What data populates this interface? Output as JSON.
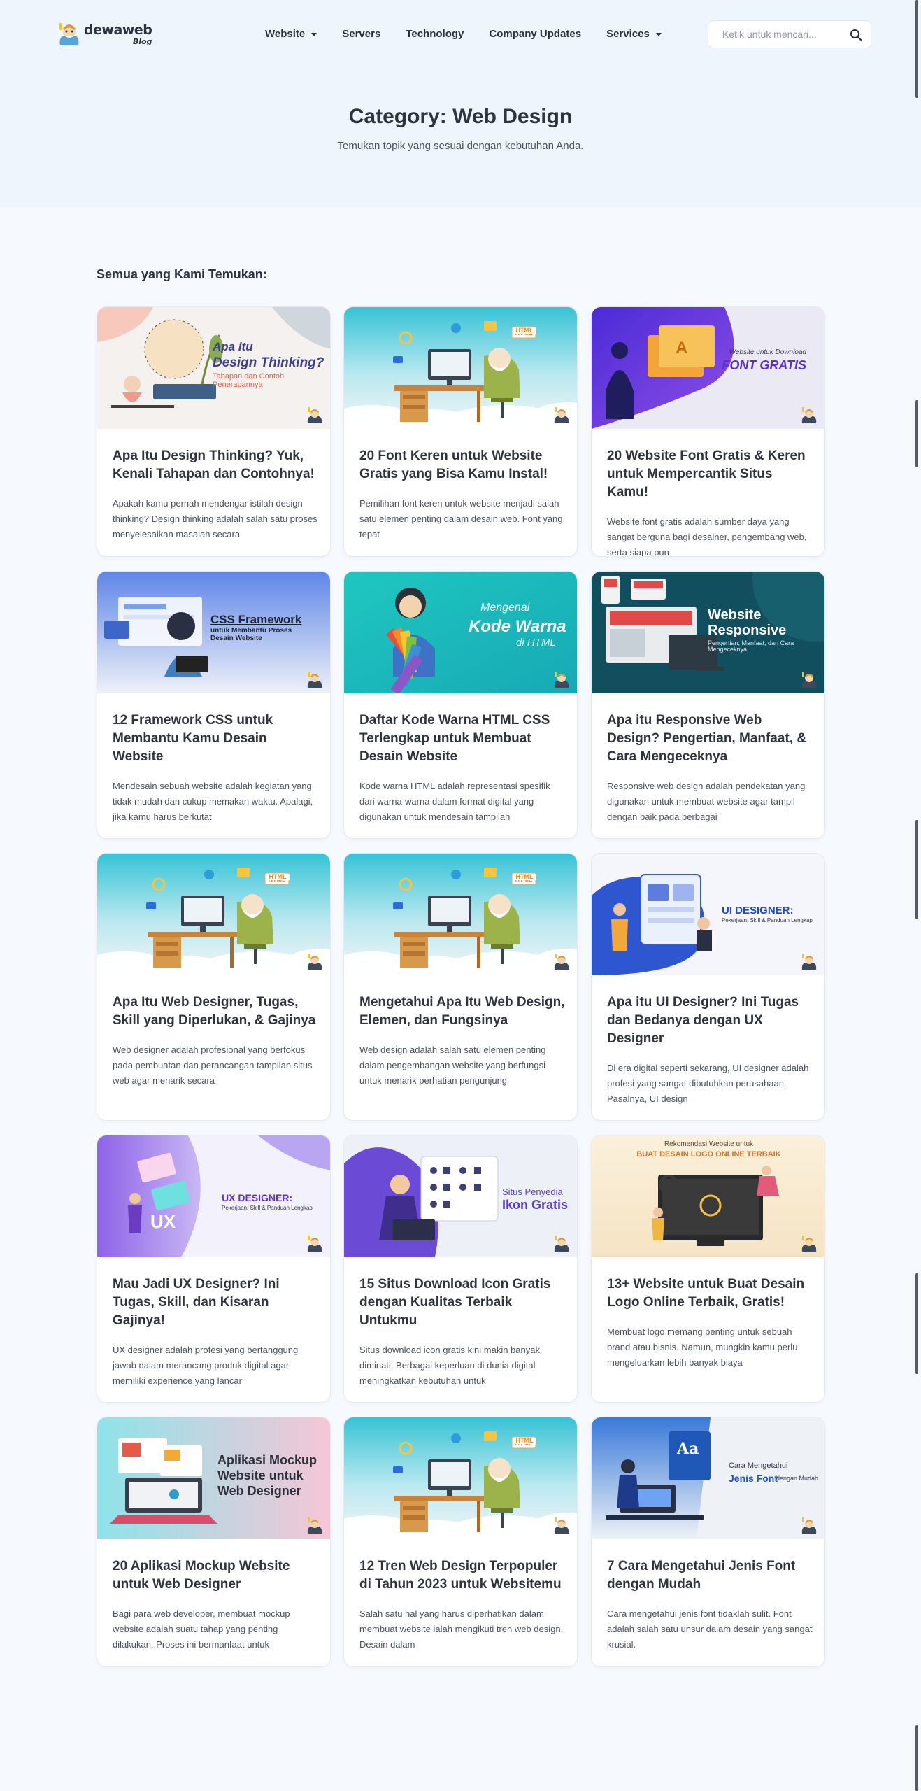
{
  "brand": {
    "name": "dewaweb",
    "sub": "Blog"
  },
  "nav": [
    {
      "label": "Website",
      "dropdown": true
    },
    {
      "label": "Servers",
      "dropdown": false
    },
    {
      "label": "Technology",
      "dropdown": false
    },
    {
      "label": "Company Updates",
      "dropdown": false
    },
    {
      "label": "Services",
      "dropdown": true
    }
  ],
  "search": {
    "placeholder": "Ketik untuk mencari...",
    "icon": "search-icon"
  },
  "hero": {
    "title": "Category: Web Design",
    "subtitle": "Temukan topik yang sesuai dengan kebutuhan Anda."
  },
  "section_label": "Semua yang Kami Temukan:",
  "posts": [
    {
      "title": "Apa Itu Design Thinking? Yuk, Kenali Tahapan dan Contohnya!",
      "excerpt": "Apakah kamu pernah mendengar istilah design thinking? Design thinking adalah salah satu proses menyelesaikan masalah secara",
      "thumb": {
        "kind": "design-thinking",
        "line1": "Apa itu",
        "line2": "Design Thinking?",
        "line3": "Tahapan dan Contoh Penerapannya"
      }
    },
    {
      "title": "20 Font Keren untuk Website Gratis yang Bisa Kamu Instal!",
      "excerpt": "Pemilihan font keren untuk website menjadi salah satu elemen penting dalam desain web. Font yang tepat",
      "thumb": {
        "kind": "desk",
        "line1": "HTML"
      }
    },
    {
      "title": "20 Website Font Gratis & Keren untuk Mempercantik Situs Kamu!",
      "excerpt": "Website font gratis adalah sumber daya yang sangat berguna bagi desainer, pengembang web, serta siapa pun",
      "thumb": {
        "kind": "font-gratis",
        "line1": "Website untuk Download",
        "line2": "FONT GRATIS"
      }
    },
    {
      "title": "12 Framework CSS untuk Membantu Kamu Desain Website",
      "excerpt": "Mendesain sebuah website adalah kegiatan yang tidak mudah dan cukup memakan waktu. Apalagi, jika kamu harus berkutat",
      "thumb": {
        "kind": "css-framework",
        "line1": "CSS Framework",
        "line2": "untuk Membantu Proses Desain Website"
      }
    },
    {
      "title": "Daftar Kode Warna HTML CSS Terlengkap untuk Membuat Desain Website",
      "excerpt": "Kode warna HTML adalah representasi spesifik dari warna-warna dalam format digital yang digunakan untuk mendesain tampilan",
      "thumb": {
        "kind": "kode-warna",
        "line1": "Mengenal",
        "line2": "Kode Warna",
        "line3": "di HTML"
      }
    },
    {
      "title": "Apa itu Responsive Web Design? Pengertian, Manfaat, & Cara Mengeceknya",
      "excerpt": "Responsive web design adalah pendekatan yang digunakan untuk membuat website agar tampil dengan baik pada berbagai",
      "thumb": {
        "kind": "responsive",
        "line1": "Website",
        "line2": "Responsive",
        "line3": "Pengertian, Manfaat, dan Cara Mengeceknya"
      }
    },
    {
      "title": "Apa Itu Web Designer, Tugas, Skill yang Diperlukan, & Gajinya",
      "excerpt": "Web designer adalah profesional yang berfokus pada pembuatan dan perancangan tampilan situs web agar menarik secara",
      "thumb": {
        "kind": "desk",
        "line1": "HTML"
      }
    },
    {
      "title": "Mengetahui Apa Itu Web Design, Elemen, dan Fungsinya",
      "excerpt": "Web design adalah salah satu elemen penting dalam pengembangan website yang berfungsi untuk menarik perhatian pengunjung",
      "thumb": {
        "kind": "desk",
        "line1": "HTML"
      }
    },
    {
      "title": "Apa itu UI Designer? Ini Tugas dan Bedanya dengan UX Designer",
      "excerpt": "Di era digital seperti sekarang, UI designer adalah profesi yang sangat dibutuhkan perusahaan. Pasalnya, UI design",
      "thumb": {
        "kind": "ui-designer",
        "line1": "UI DESIGNER:",
        "line2": "Pekerjaan, Skill & Panduan Lengkap"
      }
    },
    {
      "title": "Mau Jadi UX Designer? Ini Tugas, Skill, dan Kisaran Gajinya!",
      "excerpt": "UX designer adalah profesi yang bertanggung jawab dalam merancang produk digital agar memiliki experience yang lancar",
      "thumb": {
        "kind": "ux-designer",
        "line1": "UX DESIGNER:",
        "line2": "Pekerjaan, Skill & Panduan Lengkap"
      }
    },
    {
      "title": "15 Situs Download Icon Gratis dengan Kualitas Terbaik Untukmu",
      "excerpt": "Situs download icon gratis kini makin banyak diminati. Berbagai keperluan di dunia digital meningkatkan kebutuhan untuk",
      "thumb": {
        "kind": "ikon-gratis",
        "line1": "Situs Penyedia",
        "line2": "Ikon Gratis"
      }
    },
    {
      "title": "13+ Website untuk Buat Desain Logo Online Terbaik, Gratis!",
      "excerpt": "Membuat logo memang penting untuk sebuah brand atau bisnis. Namun, mungkin kamu perlu mengeluarkan lebih banyak biaya",
      "thumb": {
        "kind": "logo-online",
        "line1": "Rekomendasi Website untuk",
        "line2": "BUAT DESAIN LOGO ONLINE TERBAIK"
      }
    },
    {
      "title": "20 Aplikasi Mockup Website untuk Web Designer",
      "excerpt": "Bagi para web developer, membuat mockup website adalah suatu tahap yang penting dilakukan. Proses ini bermanfaat untuk",
      "thumb": {
        "kind": "mockup",
        "line1": "Aplikasi Mockup",
        "line2": "Website untuk",
        "line3": "Web Designer"
      }
    },
    {
      "title": "12 Tren Web Design Terpopuler di Tahun 2023 untuk Websitemu",
      "excerpt": "Salah satu hal yang harus diperhatikan dalam membuat website ialah mengikuti tren web design. Desain dalam",
      "thumb": {
        "kind": "desk",
        "line1": "HTML"
      }
    },
    {
      "title": "7 Cara Mengetahui Jenis Font dengan Mudah",
      "excerpt": "Cara mengetahui jenis font tidaklah sulit. Font adalah salah satu unsur dalam desain yang sangat krusial.",
      "thumb": {
        "kind": "jenis-font",
        "line1": "Cara Mengetahui",
        "line2": "Jenis Font",
        "line3": "dengan Mudah"
      }
    }
  ]
}
